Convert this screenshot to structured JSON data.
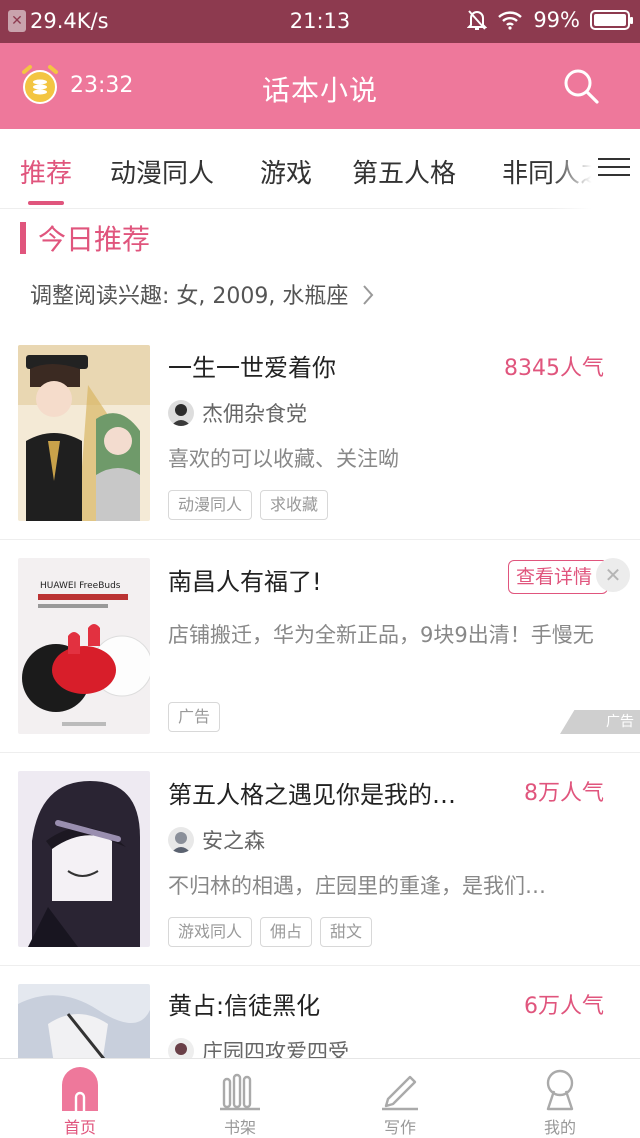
{
  "status_bar": {
    "speed": "29.4K/s",
    "time": "21:13",
    "battery": "99%",
    "battery_level": 0.99
  },
  "header": {
    "timer": "23:32",
    "title": "话本小说",
    "search_icon": "search-icon"
  },
  "tabs": {
    "items": [
      "推荐",
      "动漫同人",
      "游戏",
      "第五人格",
      "非同人之"
    ],
    "active": 0
  },
  "section": {
    "title": "今日推荐",
    "prefs": "调整阅读兴趣: 女, 2009, 水瓶座"
  },
  "books": [
    {
      "title": "一生一世爱着你",
      "popularity": "8345人气",
      "author": "杰佣杂食党",
      "desc": "喜欢的可以收藏、关注呦",
      "tags": [
        "动漫同人",
        "求收藏"
      ]
    },
    {
      "title": "第五人格之遇见你是我的…",
      "popularity": "8万人气",
      "author": "安之森",
      "desc": "不归林的相遇，庄园里的重逢，是我们…",
      "tags": [
        "游戏同人",
        "佣占",
        "甜文"
      ]
    },
    {
      "title": "黄占:信徒黑化",
      "popularity": "6万人气",
      "author": "庄园四攻爱四受",
      "desc": "",
      "tags": []
    }
  ],
  "ad": {
    "title": "南昌人有福了!",
    "detail_label": "查看详情",
    "desc": "店铺搬迁，华为全新正品，9块9出清！手慢无",
    "tag": "广告",
    "mark": "广告",
    "image_brand": "HUAWEI FreeBuds"
  },
  "bottom_nav": {
    "items": [
      "首页",
      "书架",
      "写作",
      "我的"
    ],
    "active": 0
  },
  "colors": {
    "accent": "#e0557d",
    "header": "#ee789b",
    "status_bar": "#8d3a4f"
  }
}
